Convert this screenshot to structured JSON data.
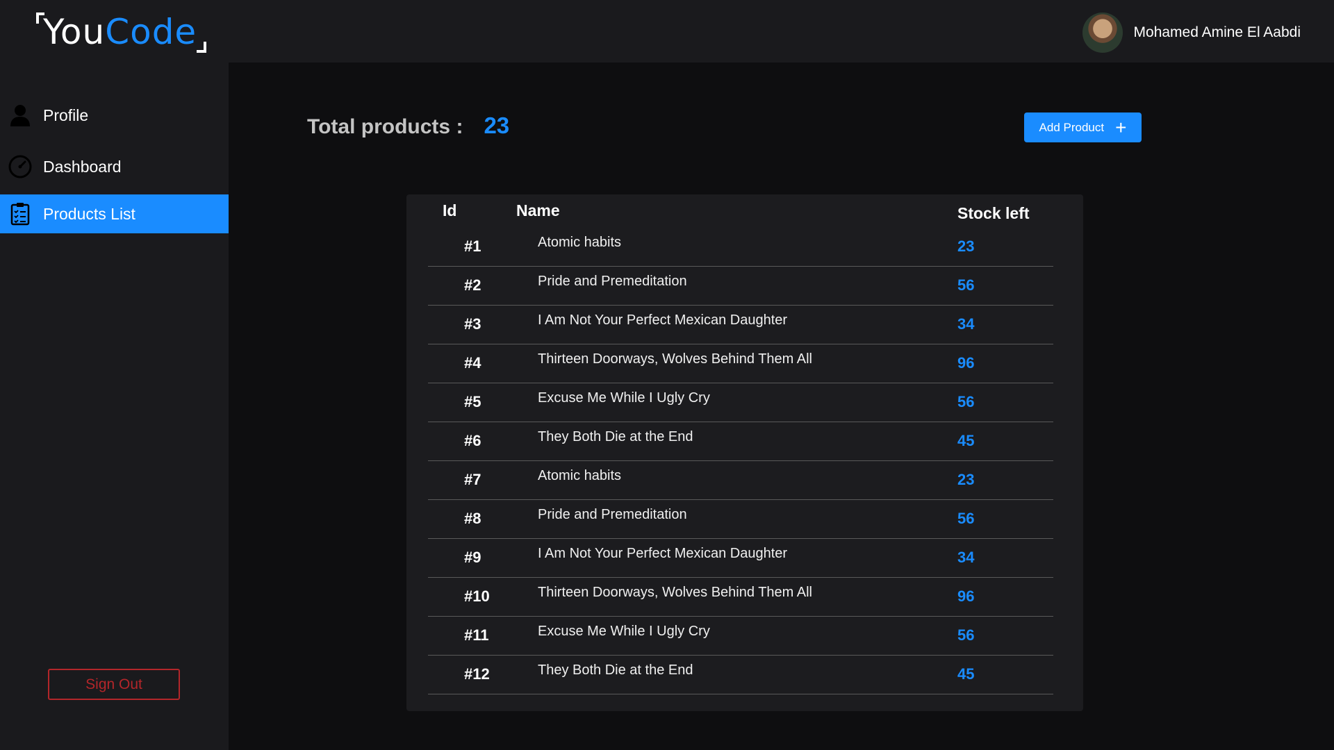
{
  "header": {
    "logo_you": "You",
    "logo_code": "Code",
    "user_name": "Mohamed Amine El Aabdi"
  },
  "sidebar": {
    "items": [
      {
        "label": "Profile",
        "icon": "user-icon"
      },
      {
        "label": "Dashboard",
        "icon": "speedometer-icon"
      },
      {
        "label": "Products List",
        "icon": "clipboard-list-icon",
        "active": true
      }
    ],
    "sign_out": "Sign Out"
  },
  "main": {
    "total_label": "Total products :",
    "total_value": "23",
    "add_button": "Add Product",
    "table": {
      "headers": {
        "id": "Id",
        "name": "Name",
        "stock": "Stock left"
      },
      "rows": [
        {
          "id": "#1",
          "name": "Atomic habits",
          "stock": "23"
        },
        {
          "id": "#2",
          "name": "Pride and Premeditation",
          "stock": "56"
        },
        {
          "id": "#3",
          "name": "I Am Not Your Perfect Mexican Daughter",
          "stock": "34"
        },
        {
          "id": "#4",
          "name": "Thirteen Doorways, Wolves Behind Them All",
          "stock": "96"
        },
        {
          "id": "#5",
          "name": "Excuse Me While I Ugly Cry",
          "stock": "56"
        },
        {
          "id": "#6",
          "name": "They Both Die at the End",
          "stock": "45"
        },
        {
          "id": "#7",
          "name": "Atomic habits",
          "stock": "23"
        },
        {
          "id": "#8",
          "name": "Pride and Premeditation",
          "stock": "56"
        },
        {
          "id": "#9",
          "name": "I Am Not Your Perfect Mexican Daughter",
          "stock": "34"
        },
        {
          "id": "#10",
          "name": "Thirteen Doorways, Wolves Behind Them All",
          "stock": "96"
        },
        {
          "id": "#11",
          "name": "Excuse Me While I Ugly Cry",
          "stock": "56"
        },
        {
          "id": "#12",
          "name": "They Both Die at the End",
          "stock": "45"
        }
      ]
    }
  },
  "colors": {
    "accent": "#1a8cff",
    "danger": "#b3262a",
    "panel": "#1a1a1d",
    "background": "#0e0e10"
  }
}
